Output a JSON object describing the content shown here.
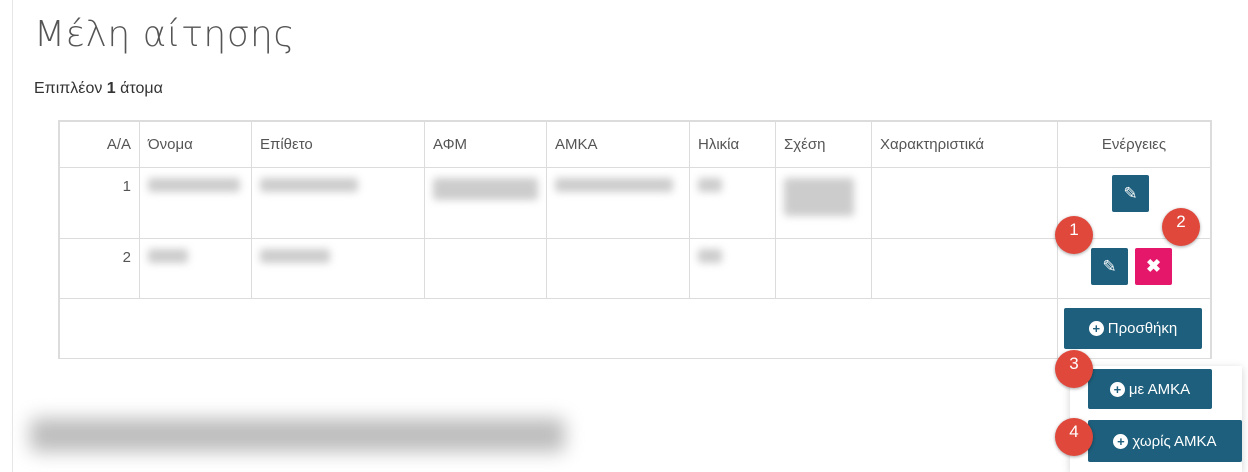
{
  "page": {
    "title": "Μέλη αίτησης",
    "subtitle_prefix": "Επιπλέον ",
    "subtitle_count": "1",
    "subtitle_suffix": " άτομα"
  },
  "table": {
    "headers": [
      "Α/Α",
      "Όνομα",
      "Επίθετο",
      "ΑΦΜ",
      "ΑΜΚΑ",
      "Ηλικία",
      "Σχέση",
      "Χαρακτηριστικά",
      "Ενέργειες"
    ],
    "rows": [
      {
        "aa": "1"
      },
      {
        "aa": "2"
      }
    ]
  },
  "actions": {
    "edit_icon": "edit-icon",
    "delete_icon": "close-icon",
    "delete_glyph": "✖",
    "edit_glyph": "✎",
    "plus_glyph": "+",
    "add_label": "Προσθήκη",
    "with_amka_label": "με ΑΜΚΑ",
    "without_amka_label": "χωρίς ΑΜΚΑ"
  },
  "badges": [
    "1",
    "2",
    "3",
    "4"
  ],
  "colors": {
    "primary": "#1d5f7c",
    "danger": "#e5176b",
    "badge": "#e0483c"
  }
}
